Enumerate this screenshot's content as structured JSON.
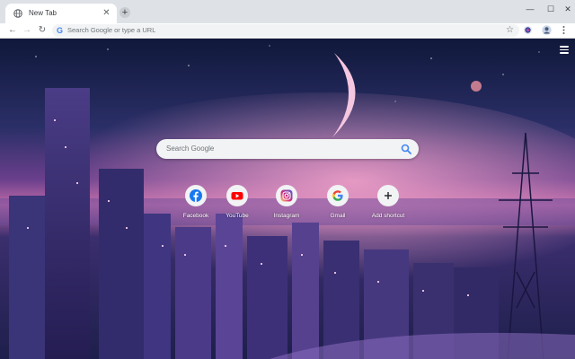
{
  "browser": {
    "tab": {
      "title": "New Tab"
    },
    "new_tab_symbol": "+",
    "window_controls": {
      "minimize": "—",
      "maximize": "☐",
      "close": "✕"
    },
    "toolbar": {
      "back": "←",
      "forward": "→",
      "reload": "↻",
      "omnibox_g": "G",
      "omnibox_placeholder": "Search Google or type a URL",
      "star": "☆"
    }
  },
  "ntp": {
    "search_placeholder": "Search Google",
    "shortcuts": [
      {
        "label": "Facebook",
        "icon": "facebook-icon",
        "color": "#1877f2"
      },
      {
        "label": "YouTube",
        "icon": "youtube-icon",
        "color": "#ff0000"
      },
      {
        "label": "Instagram",
        "icon": "instagram-icon",
        "color": "#c13584"
      },
      {
        "label": "Gmail",
        "icon": "google-icon",
        "color": "#4285f4"
      },
      {
        "label": "Add shortcut",
        "icon": "plus-icon",
        "color": "#202124"
      }
    ]
  },
  "colors": {
    "accent": "#4285f4",
    "tabstrip": "#dee1e6"
  }
}
